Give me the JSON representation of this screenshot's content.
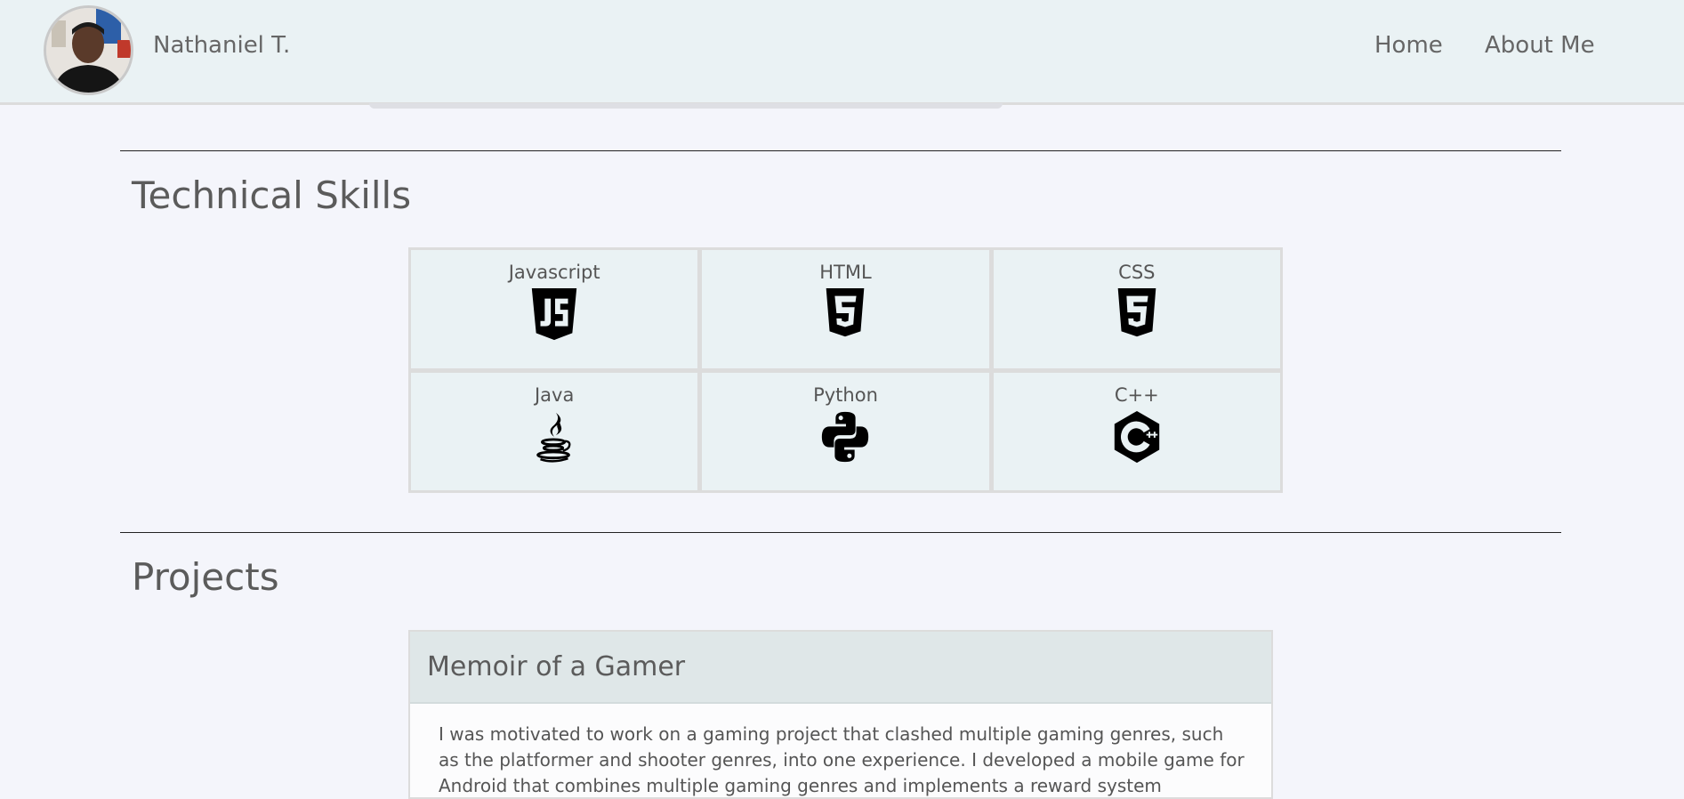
{
  "navbar": {
    "brand_name": "Nathaniel T.",
    "links": [
      {
        "label": "Home"
      },
      {
        "label": "About Me"
      }
    ]
  },
  "skills": {
    "title": "Technical Skills",
    "items": [
      {
        "label": "Javascript",
        "icon": "javascript-icon"
      },
      {
        "label": "HTML",
        "icon": "html5-icon"
      },
      {
        "label": "CSS",
        "icon": "css3-icon"
      },
      {
        "label": "Java",
        "icon": "java-icon"
      },
      {
        "label": "Python",
        "icon": "python-icon"
      },
      {
        "label": "C++",
        "icon": "cplusplus-icon"
      }
    ]
  },
  "projects": {
    "title": "Projects",
    "items": [
      {
        "title": "Memoir of a Gamer",
        "description": "I was motivated to work on a gaming project that clashed multiple gaming genres, such as the platformer and shooter genres, into one experience. I developed a mobile game for Android that combines multiple gaming genres and implements a reward system"
      }
    ]
  },
  "colors": {
    "page_background": "#f4f5fb",
    "navbar_background": "#eaf2f4",
    "card_header": "#dfe7e8",
    "text": "#555555"
  }
}
